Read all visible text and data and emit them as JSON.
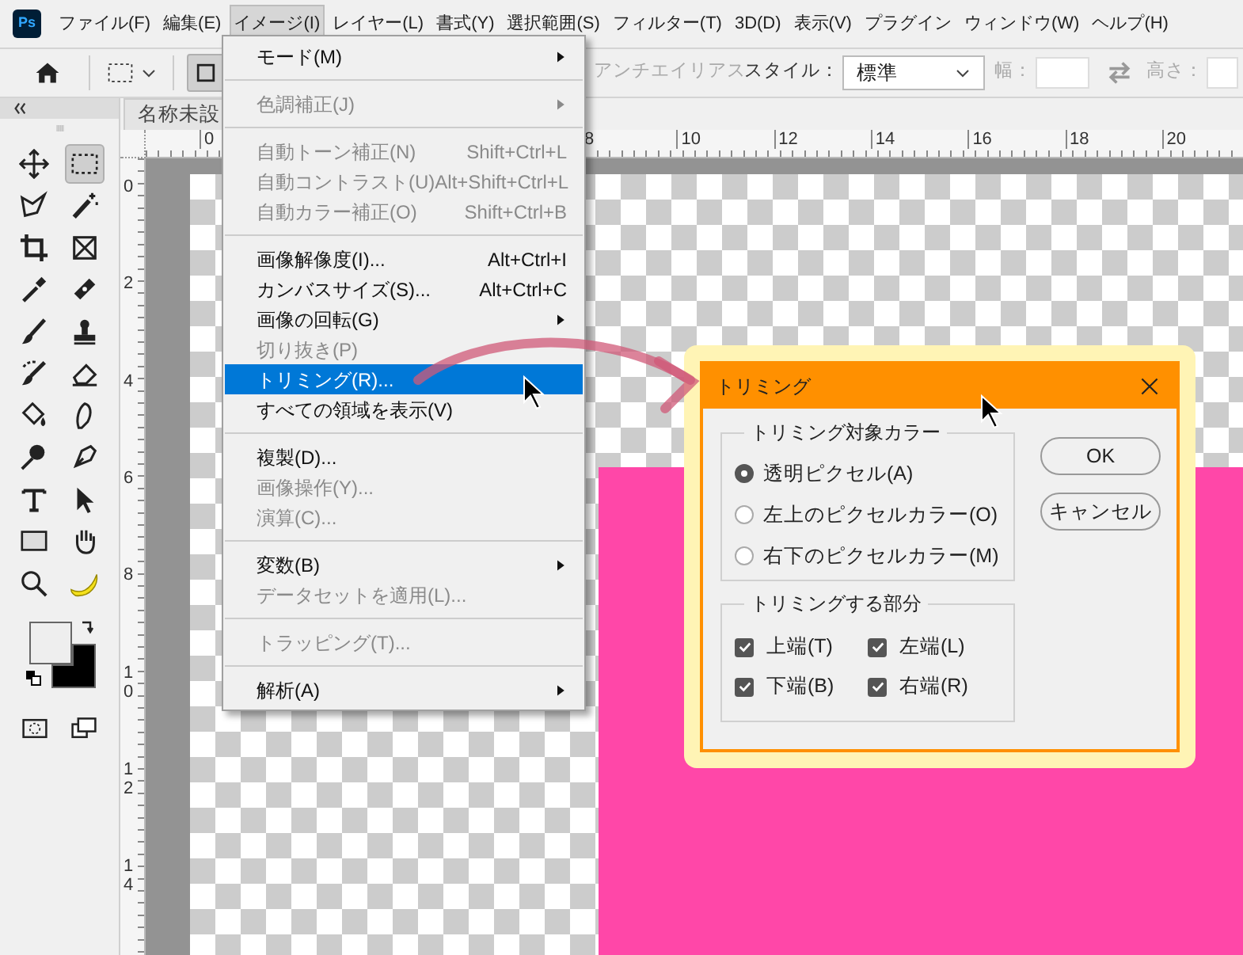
{
  "app": {
    "logo": "Ps"
  },
  "menubar": [
    {
      "label": "ファイル(F)",
      "selected": false
    },
    {
      "label": "編集(E)",
      "selected": false
    },
    {
      "label": "イメージ(I)",
      "selected": true
    },
    {
      "label": "レイヤー(L)",
      "selected": false
    },
    {
      "label": "書式(Y)",
      "selected": false
    },
    {
      "label": "選択範囲(S)",
      "selected": false
    },
    {
      "label": "フィルター(T)",
      "selected": false
    },
    {
      "label": "3D(D)",
      "selected": false
    },
    {
      "label": "表示(V)",
      "selected": false
    },
    {
      "label": "プラグイン",
      "selected": false
    },
    {
      "label": "ウィンドウ(W)",
      "selected": false
    },
    {
      "label": "ヘルプ(H)",
      "selected": false
    }
  ],
  "options_bar": {
    "shape_selected": true,
    "antialias": {
      "label": "アンチエイリアス",
      "disabled": true
    },
    "style_label": "スタイル：",
    "style_value": "標準",
    "width_label": "幅：",
    "height_label": "高さ："
  },
  "document_tab": {
    "title": "名称未設"
  },
  "ruler": {
    "horizontal_labels": [
      "0",
      "8",
      "10",
      "12",
      "14",
      "16",
      "18",
      "20"
    ],
    "vertical_labels": [
      "0",
      "2",
      "4",
      "6",
      "8",
      "10",
      "12",
      "14"
    ]
  },
  "toolbar": {
    "tools": [
      {
        "selected": false
      },
      {
        "selected": true
      },
      {
        "selected": false
      },
      {
        "selected": false
      },
      {
        "selected": false
      },
      {
        "selected": false
      },
      {
        "selected": false
      },
      {
        "selected": false
      },
      {
        "selected": false
      },
      {
        "selected": false
      },
      {
        "selected": false
      },
      {
        "selected": false
      },
      {
        "selected": false
      },
      {
        "selected": false
      },
      {
        "selected": false
      },
      {
        "selected": false
      },
      {
        "selected": false
      },
      {
        "selected": false
      },
      {
        "selected": false
      },
      {
        "selected": false
      },
      {
        "selected": false
      },
      {
        "selected": false
      }
    ],
    "swatches": [
      {
        "color": "#eeeeee"
      },
      {
        "color": "#000000"
      }
    ]
  },
  "image_menu": [
    {
      "kind": "item",
      "label": "モード(M)",
      "disabled": false,
      "submenu": true,
      "selected": false
    },
    {
      "kind": "separator"
    },
    {
      "kind": "item",
      "label": "色調補正(J)",
      "disabled": true,
      "submenu": true,
      "selected": false
    },
    {
      "kind": "separator"
    },
    {
      "kind": "item",
      "label": "自動トーン補正(N)",
      "shortcut": "Shift+Ctrl+L",
      "disabled": true,
      "submenu": false,
      "selected": false
    },
    {
      "kind": "item",
      "label": "自動コントラスト(U)",
      "shortcut": "Alt+Shift+Ctrl+L",
      "disabled": true,
      "submenu": false,
      "selected": false
    },
    {
      "kind": "item",
      "label": "自動カラー補正(O)",
      "shortcut": "Shift+Ctrl+B",
      "disabled": true,
      "submenu": false,
      "selected": false
    },
    {
      "kind": "separator"
    },
    {
      "kind": "item",
      "label": "画像解像度(I)...",
      "shortcut": "Alt+Ctrl+I",
      "disabled": false,
      "submenu": false,
      "selected": false
    },
    {
      "kind": "item",
      "label": "カンバスサイズ(S)...",
      "shortcut": "Alt+Ctrl+C",
      "disabled": false,
      "submenu": false,
      "selected": false
    },
    {
      "kind": "item",
      "label": "画像の回転(G)",
      "disabled": false,
      "submenu": true,
      "selected": false
    },
    {
      "kind": "item",
      "label": "切り抜き(P)",
      "disabled": true,
      "submenu": false,
      "selected": false
    },
    {
      "kind": "item",
      "label": "トリミング(R)...",
      "disabled": false,
      "submenu": false,
      "selected": true
    },
    {
      "kind": "item",
      "label": "すべての領域を表示(V)",
      "disabled": false,
      "submenu": false,
      "selected": false
    },
    {
      "kind": "separator"
    },
    {
      "kind": "item",
      "label": "複製(D)...",
      "disabled": false,
      "submenu": false,
      "selected": false
    },
    {
      "kind": "item",
      "label": "画像操作(Y)...",
      "disabled": true,
      "submenu": false,
      "selected": false
    },
    {
      "kind": "item",
      "label": "演算(C)...",
      "disabled": true,
      "submenu": false,
      "selected": false
    },
    {
      "kind": "separator"
    },
    {
      "kind": "item",
      "label": "変数(B)",
      "disabled": false,
      "submenu": true,
      "selected": false
    },
    {
      "kind": "item",
      "label": "データセットを適用(L)...",
      "disabled": true,
      "submenu": false,
      "selected": false
    },
    {
      "kind": "separator"
    },
    {
      "kind": "item",
      "label": "トラッピング(T)...",
      "disabled": true,
      "submenu": false,
      "selected": false
    },
    {
      "kind": "separator"
    },
    {
      "kind": "item",
      "label": "解析(A)",
      "disabled": false,
      "submenu": true,
      "selected": false
    }
  ],
  "dialog": {
    "title": "トリミング",
    "color_group": {
      "legend": "トリミング対象カラー",
      "options": [
        {
          "label": "透明ピクセル(A)",
          "selected": true
        },
        {
          "label": "左上のピクセルカラー(O)",
          "selected": false
        },
        {
          "label": "右下のピクセルカラー(M)",
          "selected": false
        }
      ]
    },
    "trim_group": {
      "legend": "トリミングする部分",
      "options": [
        {
          "label": "上端(T)",
          "checked": true
        },
        {
          "label": "左端(L)",
          "checked": true
        },
        {
          "label": "下端(B)",
          "checked": true
        },
        {
          "label": "右端(R)",
          "checked": true
        }
      ]
    },
    "buttons": [
      "OK",
      "キャンセル"
    ]
  }
}
